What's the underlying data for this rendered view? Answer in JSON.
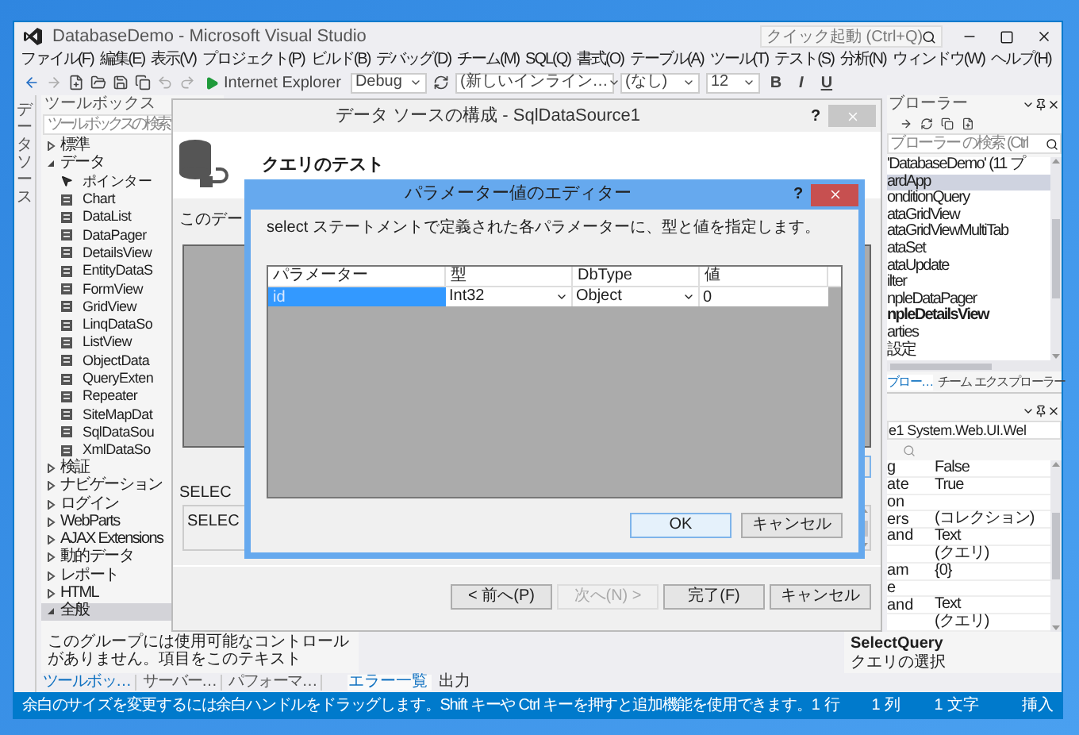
{
  "window": {
    "title": "DatabaseDemo - Microsoft Visual Studio",
    "quick_launch": {
      "placeholder": "クイック起動 (Ctrl+Q)"
    }
  },
  "menu": [
    "ファイル(F)",
    "編集(E)",
    "表示(V)",
    "プロジェクト(P)",
    "ビルド(B)",
    "デバッグ(D)",
    "チーム(M)",
    "SQL(Q)",
    "書式(O)",
    "テーブル(A)",
    "ツール(T)",
    "テスト(S)",
    "分析(N)",
    "ウィンドウ(W)",
    "ヘルプ(H)"
  ],
  "toolbar": {
    "browser": "Internet Explorer",
    "config": "Debug",
    "style": "(新しいインライン…",
    "target": "(なし)",
    "font_size": "12",
    "format_buttons": [
      "B",
      "I",
      "U"
    ]
  },
  "side_tab": "データソース",
  "toolbox": {
    "title": "ツールボックス",
    "search": {
      "placeholder": "ツールボックスの検索"
    },
    "groups": [
      {
        "label": "標準",
        "expanded": false,
        "selected": false
      },
      {
        "label": "データ",
        "expanded": true,
        "selected": false,
        "children": [
          {
            "label": "ポインター",
            "kind": "pointer"
          },
          {
            "label": "Chart",
            "kind": "control"
          },
          {
            "label": "DataList",
            "kind": "control"
          },
          {
            "label": "DataPager",
            "kind": "control"
          },
          {
            "label": "DetailsView",
            "kind": "control"
          },
          {
            "label": "EntityDataS",
            "kind": "control"
          },
          {
            "label": "FormView",
            "kind": "control"
          },
          {
            "label": "GridView",
            "kind": "control"
          },
          {
            "label": "LinqDataSo",
            "kind": "control"
          },
          {
            "label": "ListView",
            "kind": "control"
          },
          {
            "label": "ObjectData",
            "kind": "control"
          },
          {
            "label": "QueryExten",
            "kind": "control"
          },
          {
            "label": "Repeater",
            "kind": "control"
          },
          {
            "label": "SiteMapDat",
            "kind": "control"
          },
          {
            "label": "SqlDataSou",
            "kind": "control"
          },
          {
            "label": "XmlDataSo",
            "kind": "control"
          }
        ]
      },
      {
        "label": "検証",
        "expanded": false,
        "selected": false
      },
      {
        "label": "ナビゲーション",
        "expanded": false,
        "selected": false
      },
      {
        "label": "ログイン",
        "expanded": false,
        "selected": false
      },
      {
        "label": "WebParts",
        "expanded": false,
        "selected": false
      },
      {
        "label": "AJAX Extensions",
        "expanded": false,
        "selected": false
      },
      {
        "label": "動的データ",
        "expanded": false,
        "selected": false
      },
      {
        "label": "レポート",
        "expanded": false,
        "selected": false
      },
      {
        "label": "HTML",
        "expanded": false,
        "selected": false
      },
      {
        "label": "全般",
        "expanded": true,
        "selected": true
      }
    ],
    "note": "このグループには使用可能なコントロールがありません。項目をこのテキスト"
  },
  "bottom_tabs_left": [
    {
      "label": "ツールボッ…",
      "selected": true
    },
    {
      "label": "サーバー…",
      "selected": false
    },
    {
      "label": "パフォーマ…",
      "selected": false
    }
  ],
  "bottom_tabs_center": [
    {
      "label": "エラー一覧",
      "selected": true
    },
    {
      "label": "出力",
      "selected": false
    }
  ],
  "wizard": {
    "title": "データ ソースの構成 - SqlDataSource1",
    "help": "?",
    "heading": "クエリのテスト",
    "intro": "このデー",
    "select_label": "SELEC",
    "select_text": "SELEC",
    "buttons": [
      {
        "label": "< 前へ(P)",
        "disabled": false
      },
      {
        "label": "次へ(N) >",
        "disabled": true
      },
      {
        "label": "完了(F)",
        "disabled": false
      },
      {
        "label": "キャンセル",
        "disabled": false
      }
    ]
  },
  "param_dialog": {
    "title": "パラメーター値のエディター",
    "help": "?",
    "description": "select ステートメントで定義された各パラメーターに、型と値を指定します。",
    "columns": [
      "パラメーター",
      "型",
      "DbType",
      "値"
    ],
    "rows": [
      {
        "name": "id",
        "type": "Int32",
        "db_type": "Object",
        "value": "0",
        "selected": true
      }
    ],
    "buttons": [
      "OK",
      "キャンセル"
    ]
  },
  "solution_explorer": {
    "title": "ブローラー",
    "search": {
      "placeholder": "ブローラー の検索 (Ctrl"
    },
    "items": [
      {
        "label": "'DatabaseDemo' (11 プ",
        "selected": false,
        "startup": false
      },
      {
        "label": "ardApp",
        "selected": true,
        "startup": false
      },
      {
        "label": "onditionQuery",
        "selected": false,
        "startup": false
      },
      {
        "label": "ataGridView",
        "selected": false,
        "startup": false
      },
      {
        "label": "ataGridViewMultiTab",
        "selected": false,
        "startup": false
      },
      {
        "label": "ataSet",
        "selected": false,
        "startup": false
      },
      {
        "label": "ataUpdate",
        "selected": false,
        "startup": false
      },
      {
        "label": "ilter",
        "selected": false,
        "startup": false
      },
      {
        "label": "npleDataPager",
        "selected": false,
        "startup": false
      },
      {
        "label": "npleDetailsView",
        "selected": false,
        "startup": true
      },
      {
        "label": "arties",
        "selected": false,
        "startup": false
      },
      {
        "label": "設定",
        "selected": false,
        "startup": false
      }
    ]
  },
  "panel_tabs": [
    {
      "label": "ブロー…",
      "selected": true
    },
    {
      "label": "チーム エクスプローラー",
      "selected": false
    }
  ],
  "properties": {
    "object": "e1 System.Web.UI.Wel",
    "rows": [
      {
        "name": "g",
        "value": "False"
      },
      {
        "name": "ate",
        "value": "True"
      },
      {
        "name": "on"
      },
      {
        "name": "ers",
        "value": "(コレクション)"
      },
      {
        "name": "and",
        "value": "Text"
      },
      {
        "value": "(クエリ)"
      },
      {
        "name": "am",
        "value": "{0}"
      },
      {
        "name": "e"
      },
      {
        "name": "and",
        "value": "Text"
      },
      {
        "value": "(クエリ)"
      }
    ],
    "description": {
      "title": "SelectQuery",
      "text": "クエリの選択"
    }
  },
  "status_bar": {
    "message": "余白のサイズを変更するには余白ハンドルをドラッグします。Shift キーや Ctrl キーを押すと追加機能を使用できます。",
    "line": "1 行",
    "column": "1 列",
    "char": "1 文字",
    "mode": "挿入"
  }
}
